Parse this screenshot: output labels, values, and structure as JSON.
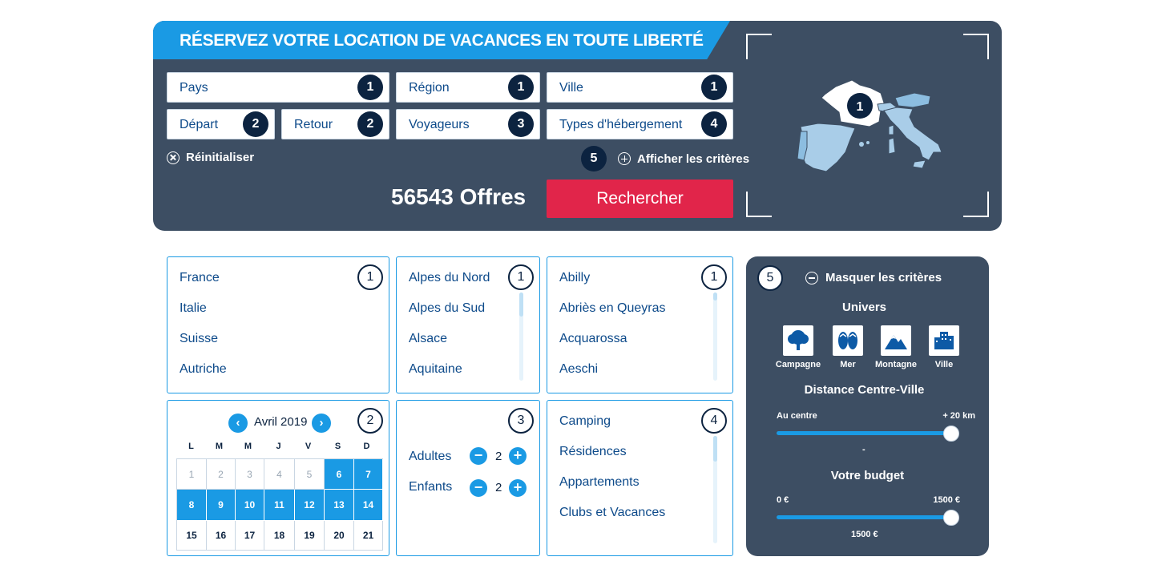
{
  "header": {
    "title": "RÉSERVEZ VOTRE LOCATION DE VACANCES EN TOUTE LIBERTÉ"
  },
  "fields": {
    "pays": {
      "label": "Pays",
      "step": "1"
    },
    "region": {
      "label": "Région",
      "step": "1"
    },
    "ville": {
      "label": "Ville",
      "step": "1"
    },
    "depart": {
      "label": "Départ",
      "step": "2"
    },
    "retour": {
      "label": "Retour",
      "step": "2"
    },
    "voyageurs": {
      "label": "Voyageurs",
      "step": "3"
    },
    "types": {
      "label": "Types d'hébergement",
      "step": "4"
    }
  },
  "actions": {
    "reset_label": "Réinitialiser",
    "show_criteria_step": "5",
    "show_criteria_label": "Afficher les critères",
    "offers_count": "56543 Offres",
    "search_label": "Rechercher"
  },
  "map": {
    "step": "1"
  },
  "countries": {
    "step": "1",
    "items": [
      "France",
      "Italie",
      "Suisse",
      "Autriche"
    ]
  },
  "regions": {
    "step": "1",
    "items": [
      "Alpes du Nord",
      "Alpes du Sud",
      "Alsace",
      "Aquitaine"
    ]
  },
  "cities": {
    "step": "1",
    "items": [
      "Abilly",
      "Abriès en Queyras",
      "Acquarossa",
      "Aeschi"
    ]
  },
  "calendar": {
    "step": "2",
    "month": "Avril 2019",
    "prev_icon": "‹",
    "next_icon": "›",
    "weekdays": [
      "L",
      "M",
      "M",
      "J",
      "V",
      "S",
      "D"
    ],
    "days": [
      {
        "d": "1",
        "state": "past"
      },
      {
        "d": "2",
        "state": "past"
      },
      {
        "d": "3",
        "state": "past"
      },
      {
        "d": "4",
        "state": "past"
      },
      {
        "d": "5",
        "state": "past"
      },
      {
        "d": "6",
        "state": "sel"
      },
      {
        "d": "7",
        "state": "sel"
      },
      {
        "d": "8",
        "state": "sel"
      },
      {
        "d": "9",
        "state": "sel"
      },
      {
        "d": "10",
        "state": "sel"
      },
      {
        "d": "11",
        "state": "sel"
      },
      {
        "d": "12",
        "state": "sel"
      },
      {
        "d": "13",
        "state": "sel"
      },
      {
        "d": "14",
        "state": "sel"
      },
      {
        "d": "15",
        "state": ""
      },
      {
        "d": "16",
        "state": ""
      },
      {
        "d": "17",
        "state": ""
      },
      {
        "d": "18",
        "state": ""
      },
      {
        "d": "19",
        "state": ""
      },
      {
        "d": "20",
        "state": ""
      },
      {
        "d": "21",
        "state": ""
      }
    ]
  },
  "travellers": {
    "step": "3",
    "adults_label": "Adultes",
    "adults_value": "2",
    "children_label": "Enfants",
    "children_value": "2",
    "minus": "−",
    "plus": "+"
  },
  "accommodation": {
    "step": "4",
    "items": [
      "Camping",
      "Résidences",
      "Appartements",
      "Clubs et Vacances"
    ]
  },
  "criteria": {
    "step": "5",
    "hide_label": "Masquer les critères",
    "universe_title": "Univers",
    "universes": [
      {
        "label": "Campagne",
        "icon": "tree-icon"
      },
      {
        "label": "Mer",
        "icon": "flip-flops-icon"
      },
      {
        "label": "Montagne",
        "icon": "mountain-icon"
      },
      {
        "label": "Ville",
        "icon": "buildings-icon"
      }
    ],
    "distance_title": "Distance Centre-Ville",
    "distance_min": "Au centre",
    "distance_max": "+ 20 km",
    "distance_value_label": "-",
    "distance_level": 1.0,
    "budget_title": "Votre budget",
    "budget_min": "0 €",
    "budget_max": "1500 €",
    "budget_value": "1500 €",
    "budget_level": 1.0
  },
  "colors": {
    "accent": "#1a9ae4",
    "panel": "#3d4e63",
    "cta": "#e1254a",
    "dark": "#0c2340"
  }
}
